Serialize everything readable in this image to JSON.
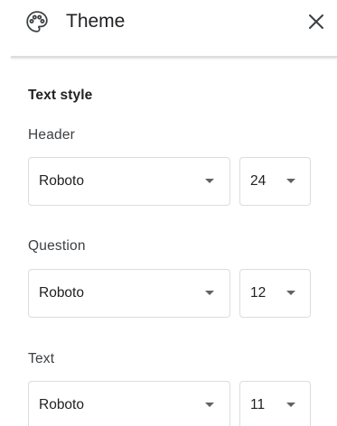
{
  "header": {
    "title": "Theme",
    "icon": "palette-icon",
    "close_icon": "close-icon"
  },
  "text_style": {
    "section_title": "Text style",
    "fields": [
      {
        "label": "Header",
        "font": "Roboto",
        "size": "24"
      },
      {
        "label": "Question",
        "font": "Roboto",
        "size": "12"
      },
      {
        "label": "Text",
        "font": "Roboto",
        "size": "11"
      }
    ]
  },
  "colors": {
    "text": "#202124",
    "border": "#dadce0",
    "icon": "#5f6368"
  }
}
